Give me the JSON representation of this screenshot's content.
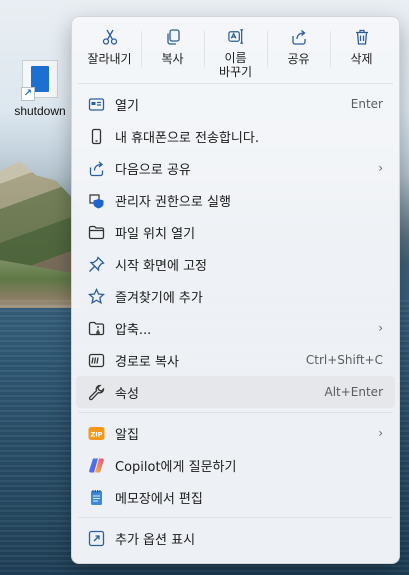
{
  "desktop": {
    "icon_label": "shutdown",
    "icon_name": "shortcut-file-icon"
  },
  "menu": {
    "toolbar": [
      {
        "label": "잘라내기",
        "icon": "cut-icon"
      },
      {
        "label": "복사",
        "icon": "copy-icon"
      },
      {
        "label": "이름 바꾸기",
        "icon": "rename-icon"
      },
      {
        "label": "공유",
        "icon": "share-icon"
      },
      {
        "label": "삭제",
        "icon": "delete-icon"
      }
    ],
    "items": [
      {
        "label": "열기",
        "shortcut": "Enter",
        "icon": "open-icon"
      },
      {
        "label": "내 휴대폰으로 전송합니다.",
        "shortcut": "",
        "icon": "phone-icon"
      },
      {
        "label": "다음으로 공유",
        "shortcut": "",
        "submenu": true,
        "icon": "share-with-icon"
      },
      {
        "label": "관리자 권한으로 실행",
        "shortcut": "",
        "icon": "admin-shield-icon"
      },
      {
        "label": "파일 위치 열기",
        "shortcut": "",
        "icon": "folder-icon"
      },
      {
        "label": "시작 화면에 고정",
        "shortcut": "",
        "icon": "pin-icon"
      },
      {
        "label": "즐겨찾기에 추가",
        "shortcut": "",
        "icon": "star-icon"
      },
      {
        "label": "압축...",
        "shortcut": "",
        "submenu": true,
        "icon": "compress-folder-icon"
      },
      {
        "label": "경로로 복사",
        "shortcut": "Ctrl+Shift+C",
        "icon": "copy-path-icon"
      },
      {
        "label": "속성",
        "shortcut": "Alt+Enter",
        "icon": "wrench-icon",
        "hover": true
      },
      {
        "label": "알집",
        "shortcut": "",
        "submenu": true,
        "icon": "zip-icon"
      },
      {
        "label": "Copilot에게 질문하기",
        "shortcut": "",
        "icon": "copilot-icon"
      },
      {
        "label": "메모장에서 편집",
        "shortcut": "",
        "icon": "notepad-icon"
      },
      {
        "label": "추가 옵션 표시",
        "shortcut": "",
        "icon": "more-options-icon"
      }
    ],
    "zip_badge": "ZIP",
    "chevron": "›"
  },
  "colors": {
    "accent": "#2d5d9a",
    "hover_bg": "#e5e7ea",
    "zip_orange": "#f39a1e"
  }
}
